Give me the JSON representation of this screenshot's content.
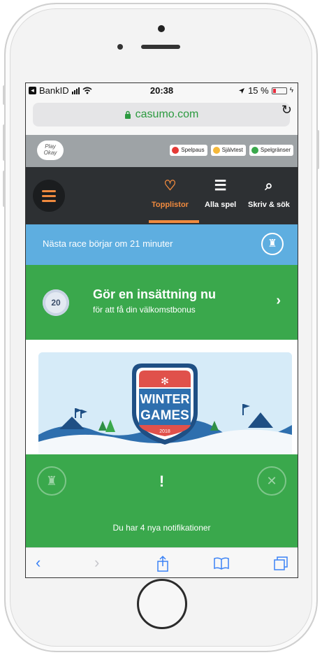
{
  "status_bar": {
    "carrier": "BankID",
    "time": "20:38",
    "battery_percent": "15 %",
    "battery_level": 0.15
  },
  "browser": {
    "url": "casumo.com",
    "reload_icon": "reload-icon",
    "lock_icon": "lock-icon"
  },
  "promo_bar": {
    "logo_line1": "Play",
    "logo_line2": "Okay",
    "pills": [
      "Spelpaus",
      "Självtest",
      "Spelgränser"
    ]
  },
  "nav": {
    "tabs": [
      {
        "label": "Topplistor",
        "icon": "heart-icon",
        "active": true
      },
      {
        "label": "Alla spel",
        "icon": "list-icon",
        "active": false
      },
      {
        "label": "Skriv & sök",
        "icon": "search-icon",
        "active": false
      }
    ]
  },
  "race": {
    "text": "Nästa race börjar om 21 minuter"
  },
  "deposit": {
    "coin": "20",
    "title": "Gör en insättning nu",
    "subtitle": "för att få din välkomstbonus",
    "arrow": "›"
  },
  "banner": {
    "line1": "WINTER",
    "line2": "GAMES",
    "year": "2018"
  },
  "notification": {
    "icon": "!",
    "text": "Du har 4 nya notifikationer"
  },
  "toolbar": {
    "items": [
      "back-icon",
      "share-icon",
      "bookmarks-icon",
      "tabs-icon"
    ]
  },
  "colors": {
    "green": "#3aa84c",
    "blue": "#5eaee0",
    "orange": "#f08a3e",
    "nav_dark": "#2d3033"
  }
}
